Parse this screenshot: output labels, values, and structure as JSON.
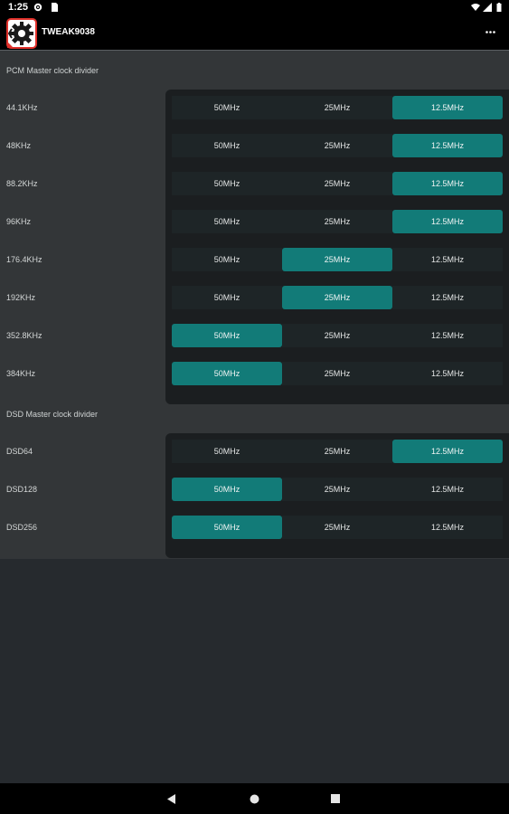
{
  "status": {
    "time": "1:25"
  },
  "app": {
    "title": "TWEAK9038",
    "overflow_icon": "more-horiz-icon"
  },
  "options": [
    "50MHz",
    "25MHz",
    "12.5MHz"
  ],
  "pcm": {
    "title": "PCM Master clock divider",
    "rows": [
      {
        "label": "44.1KHz",
        "selected": 2
      },
      {
        "label": "48KHz",
        "selected": 2
      },
      {
        "label": "88.2KHz",
        "selected": 2
      },
      {
        "label": "96KHz",
        "selected": 2
      },
      {
        "label": "176.4KHz",
        "selected": 1
      },
      {
        "label": "192KHz",
        "selected": 1
      },
      {
        "label": "352.8KHz",
        "selected": 0
      },
      {
        "label": "384KHz",
        "selected": 0
      }
    ]
  },
  "dsd": {
    "title": "DSD Master clock divider",
    "rows": [
      {
        "label": "DSD64",
        "selected": 2
      },
      {
        "label": "DSD128",
        "selected": 0
      },
      {
        "label": "DSD256",
        "selected": 0
      }
    ]
  },
  "colors": {
    "accent": "#127b78",
    "background": "#262a2e",
    "panel": "#1b1e20"
  }
}
